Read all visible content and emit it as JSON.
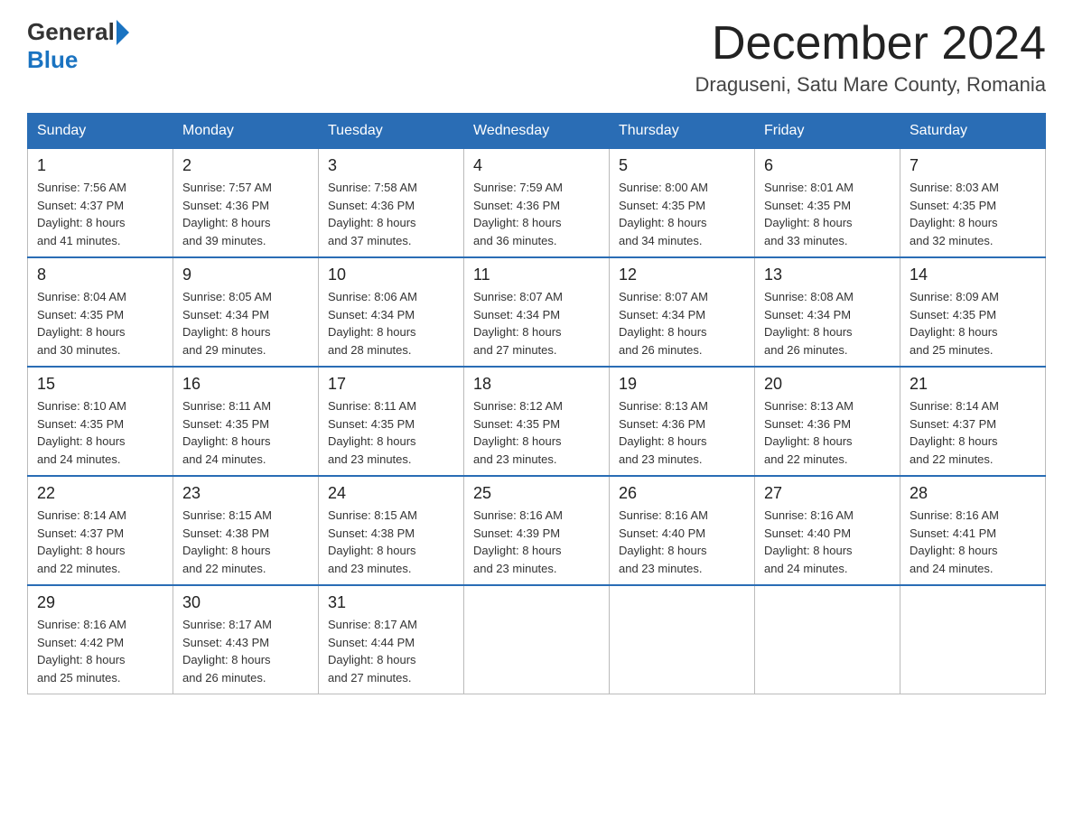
{
  "header": {
    "logo_general": "General",
    "logo_blue": "Blue",
    "month_title": "December 2024",
    "location": "Draguseni, Satu Mare County, Romania"
  },
  "calendar": {
    "days_of_week": [
      "Sunday",
      "Monday",
      "Tuesday",
      "Wednesday",
      "Thursday",
      "Friday",
      "Saturday"
    ],
    "weeks": [
      [
        {
          "day": "1",
          "sunrise": "7:56 AM",
          "sunset": "4:37 PM",
          "daylight": "8 hours and 41 minutes."
        },
        {
          "day": "2",
          "sunrise": "7:57 AM",
          "sunset": "4:36 PM",
          "daylight": "8 hours and 39 minutes."
        },
        {
          "day": "3",
          "sunrise": "7:58 AM",
          "sunset": "4:36 PM",
          "daylight": "8 hours and 37 minutes."
        },
        {
          "day": "4",
          "sunrise": "7:59 AM",
          "sunset": "4:36 PM",
          "daylight": "8 hours and 36 minutes."
        },
        {
          "day": "5",
          "sunrise": "8:00 AM",
          "sunset": "4:35 PM",
          "daylight": "8 hours and 34 minutes."
        },
        {
          "day": "6",
          "sunrise": "8:01 AM",
          "sunset": "4:35 PM",
          "daylight": "8 hours and 33 minutes."
        },
        {
          "day": "7",
          "sunrise": "8:03 AM",
          "sunset": "4:35 PM",
          "daylight": "8 hours and 32 minutes."
        }
      ],
      [
        {
          "day": "8",
          "sunrise": "8:04 AM",
          "sunset": "4:35 PM",
          "daylight": "8 hours and 30 minutes."
        },
        {
          "day": "9",
          "sunrise": "8:05 AM",
          "sunset": "4:34 PM",
          "daylight": "8 hours and 29 minutes."
        },
        {
          "day": "10",
          "sunrise": "8:06 AM",
          "sunset": "4:34 PM",
          "daylight": "8 hours and 28 minutes."
        },
        {
          "day": "11",
          "sunrise": "8:07 AM",
          "sunset": "4:34 PM",
          "daylight": "8 hours and 27 minutes."
        },
        {
          "day": "12",
          "sunrise": "8:07 AM",
          "sunset": "4:34 PM",
          "daylight": "8 hours and 26 minutes."
        },
        {
          "day": "13",
          "sunrise": "8:08 AM",
          "sunset": "4:34 PM",
          "daylight": "8 hours and 26 minutes."
        },
        {
          "day": "14",
          "sunrise": "8:09 AM",
          "sunset": "4:35 PM",
          "daylight": "8 hours and 25 minutes."
        }
      ],
      [
        {
          "day": "15",
          "sunrise": "8:10 AM",
          "sunset": "4:35 PM",
          "daylight": "8 hours and 24 minutes."
        },
        {
          "day": "16",
          "sunrise": "8:11 AM",
          "sunset": "4:35 PM",
          "daylight": "8 hours and 24 minutes."
        },
        {
          "day": "17",
          "sunrise": "8:11 AM",
          "sunset": "4:35 PM",
          "daylight": "8 hours and 23 minutes."
        },
        {
          "day": "18",
          "sunrise": "8:12 AM",
          "sunset": "4:35 PM",
          "daylight": "8 hours and 23 minutes."
        },
        {
          "day": "19",
          "sunrise": "8:13 AM",
          "sunset": "4:36 PM",
          "daylight": "8 hours and 23 minutes."
        },
        {
          "day": "20",
          "sunrise": "8:13 AM",
          "sunset": "4:36 PM",
          "daylight": "8 hours and 22 minutes."
        },
        {
          "day": "21",
          "sunrise": "8:14 AM",
          "sunset": "4:37 PM",
          "daylight": "8 hours and 22 minutes."
        }
      ],
      [
        {
          "day": "22",
          "sunrise": "8:14 AM",
          "sunset": "4:37 PM",
          "daylight": "8 hours and 22 minutes."
        },
        {
          "day": "23",
          "sunrise": "8:15 AM",
          "sunset": "4:38 PM",
          "daylight": "8 hours and 22 minutes."
        },
        {
          "day": "24",
          "sunrise": "8:15 AM",
          "sunset": "4:38 PM",
          "daylight": "8 hours and 23 minutes."
        },
        {
          "day": "25",
          "sunrise": "8:16 AM",
          "sunset": "4:39 PM",
          "daylight": "8 hours and 23 minutes."
        },
        {
          "day": "26",
          "sunrise": "8:16 AM",
          "sunset": "4:40 PM",
          "daylight": "8 hours and 23 minutes."
        },
        {
          "day": "27",
          "sunrise": "8:16 AM",
          "sunset": "4:40 PM",
          "daylight": "8 hours and 24 minutes."
        },
        {
          "day": "28",
          "sunrise": "8:16 AM",
          "sunset": "4:41 PM",
          "daylight": "8 hours and 24 minutes."
        }
      ],
      [
        {
          "day": "29",
          "sunrise": "8:16 AM",
          "sunset": "4:42 PM",
          "daylight": "8 hours and 25 minutes."
        },
        {
          "day": "30",
          "sunrise": "8:17 AM",
          "sunset": "4:43 PM",
          "daylight": "8 hours and 26 minutes."
        },
        {
          "day": "31",
          "sunrise": "8:17 AM",
          "sunset": "4:44 PM",
          "daylight": "8 hours and 27 minutes."
        },
        null,
        null,
        null,
        null
      ]
    ],
    "labels": {
      "sunrise": "Sunrise: ",
      "sunset": "Sunset: ",
      "daylight": "Daylight: "
    }
  }
}
